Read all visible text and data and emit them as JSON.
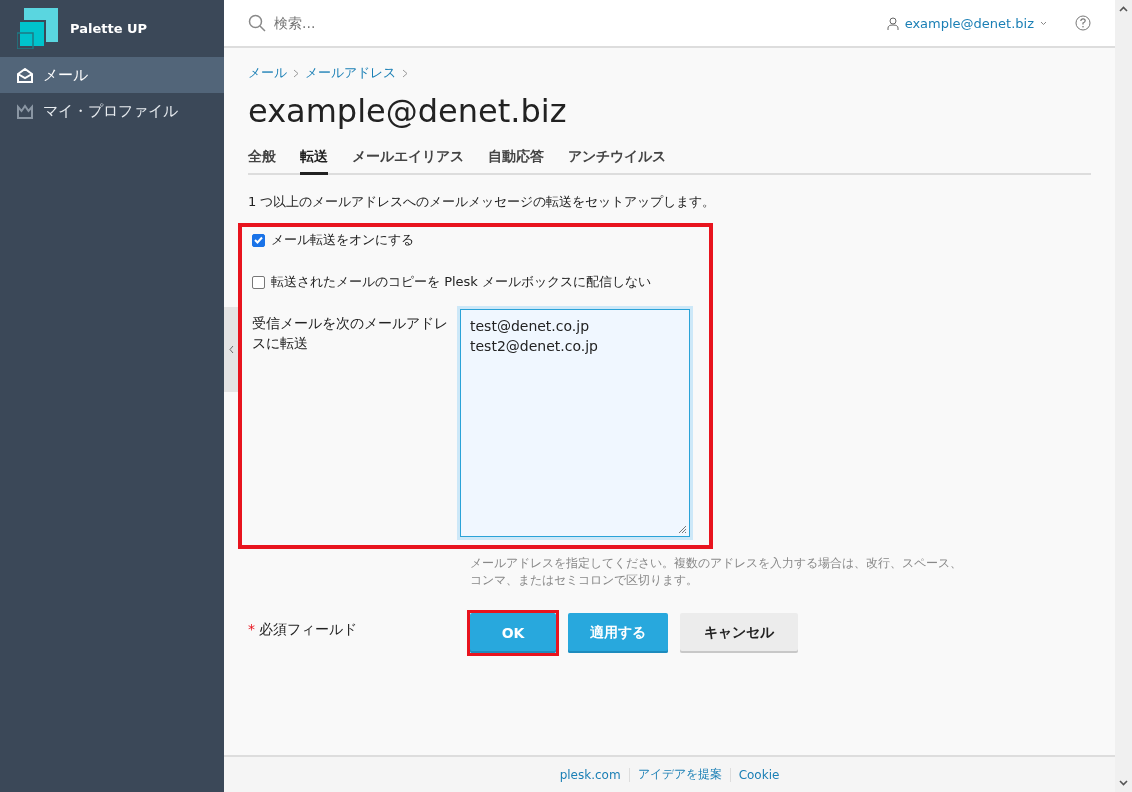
{
  "sidebar": {
    "brand": "Palette UP",
    "items": [
      {
        "label": "メール",
        "kind": "mail",
        "selected": true
      },
      {
        "label": "マイ・プロファイル",
        "kind": "crown",
        "selected": false
      }
    ]
  },
  "header": {
    "search": {
      "placeholder": "検索..."
    },
    "user": "example@denet.biz"
  },
  "breadcrumbs": [
    "メール",
    "メールアドレス"
  ],
  "title": "example@denet.biz",
  "tabs": [
    {
      "label": "全般",
      "selected": false
    },
    {
      "label": "転送",
      "selected": true
    },
    {
      "label": "メールエイリアス",
      "selected": false
    },
    {
      "label": "自動応答",
      "selected": false
    },
    {
      "label": "アンチウイルス",
      "selected": false
    }
  ],
  "description": "1 つ以上のメールアドレスへのメールメッセージの転送をセットアップします。",
  "form": {
    "highlighted": true,
    "options": [
      {
        "label": "メール転送をオンにする",
        "checked": true
      },
      {
        "label": "転送されたメールのコピーを Plesk メールボックスに配信しない",
        "checked": false
      }
    ],
    "forward_label": "受信メールを次のメールアドレスに転送",
    "forward_value": [
      "test@denet.co.jp",
      "test2@denet.co.jp"
    ],
    "hint": "メールアドレスを指定してください。複数のアドレスを入力する場合は、改行、スペース、コンマ、またはセミコロンで区切ります。"
  },
  "required_note": {
    "mark": "*",
    "text": "必須フィールド"
  },
  "buttons": [
    {
      "label": "OK",
      "kind": "primary",
      "highlighted": true
    },
    {
      "label": "適用する",
      "kind": "primary",
      "highlighted": false
    },
    {
      "label": "キャンセル",
      "kind": "secondary",
      "highlighted": false
    }
  ],
  "footer": [
    "plesk.com",
    "アイデアを提案",
    "Cookie"
  ]
}
